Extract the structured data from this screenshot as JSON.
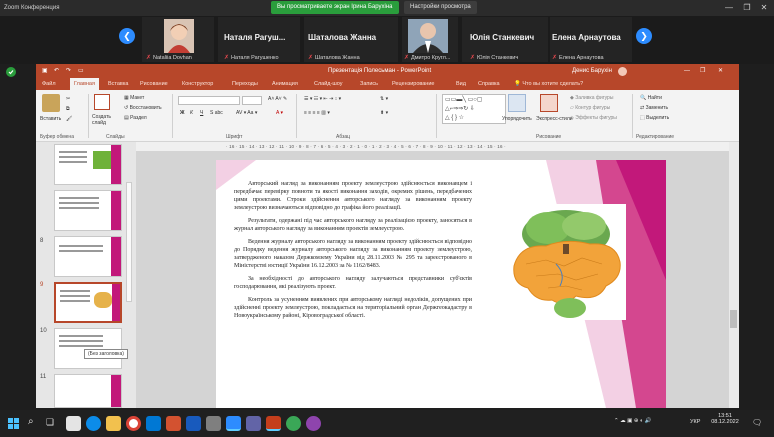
{
  "zoom": {
    "window_title": "Zoom Конференция",
    "share_banner": "Вы просматриваете экран Ірина Барухіна",
    "share_settings": "Настройки просмотра",
    "participants": [
      {
        "name": "Наталія Rатуш...",
        "sub": "Наталія Натуш..."
      },
      {
        "name": "",
        "sub": "Nataliia Dovhan"
      },
      {
        "name": "Наталя Рагуш...",
        "sub": "Наталя Рагушенко"
      },
      {
        "name": "Шаталова Жанна",
        "sub": "Шаталова Жанна"
      },
      {
        "name": "",
        "sub": "Дмитро Кругл..."
      },
      {
        "name": "Юлія Станкевич",
        "sub": "Юлія Станкевич"
      },
      {
        "name": "Елена Арнаутова",
        "sub": "Елена Арнаутова"
      }
    ],
    "controls": [
      "—",
      "❐",
      "✕"
    ]
  },
  "ppt": {
    "title": "Презентація Полесьман - PowerPoint",
    "user": "Денис Барухін",
    "tabs": [
      "Файл",
      "Главная",
      "Вставка",
      "Рисование",
      "Конструктор",
      "Переходы",
      "Анимация",
      "Слайд-шоу",
      "Запись",
      "Рецензирование",
      "Вид",
      "Справка",
      "Что вы хотите сделать?"
    ],
    "ribbon": {
      "clipboard_label": "Буфер обмена",
      "paste": "Вставить",
      "slides_label": "Слайды",
      "new_slide": "Создать слайд",
      "layout": "Макет",
      "reset": "Восстановить",
      "section": "Раздел",
      "font_label": "Шрифт",
      "paragraph_label": "Абзац",
      "drawing_label": "Рисование",
      "arrange": "Упорядочить",
      "styles": "Экспресс-стили",
      "fill": "Заливка фигуры",
      "outline": "Контур фигуры",
      "effects": "Эффекты фигуры",
      "editing_label": "Редактирование",
      "find": "Найти",
      "replace": "Заменить",
      "select": "Выделить"
    },
    "thumbnails": [
      {
        "num": ""
      },
      {
        "num": ""
      },
      {
        "num": "8"
      },
      {
        "num": "9"
      },
      {
        "num": "10"
      },
      {
        "num": "11"
      }
    ],
    "tooltip": "(Без заголовка)",
    "ruler": "· 16 · 15 · 14 · 13 · 12 · 11 · 10 · 9 · 8 · 7 · 6 · 5 · 4 · 3 · 2 · 1 · 0 · 1 · 2 · 3 · 4 · 5 · 6 · 7 · 8 · 9 · 10 · 11 · 12 · 13 · 14 · 15 · 16 ·",
    "slide_paragraphs": [
      "Авторський нагляд за виконанням проекту землеустрою здійснюється виконавцем і передбачає перевірку повноти та якості виконання заходів, окремих рішень, передбачених цими проектами. Строки здійснення авторського нагляду за виконанням проекту землеустрою визначаються відповідно до графіка його реалізації.",
      "Результати, одержані під час авторського нагляду за реалізацією проекту, заносяться в журнал авторського нагляду за виконанням проектів землеустрою.",
      "Ведення журналу авторського нагляду за виконанням проекту здійснюється відповідно до Порядку ведення журналу авторського нагляду за виконанням проекту землеустрою, затвердженого наказом Держкомзему України від 28.11.2003 № 295 та зареєстрованого в Міністерстві юстиції України 16.12.2003 за № 1162/8483.",
      "За необхідності до авторського нагляду залучаються представники суб'єктів господарювання, які реалізують проект.",
      "Контроль за усуненням виявлених при авторському нагляді недоліків, допущених при здійсненні проекту землеустрою, покладається на територіальний орган Держгеокадастру в Новоукраїнському районі, Кіровоградської області."
    ]
  },
  "taskbar": {
    "time": "13:51",
    "date": "08.12.2022",
    "lang": "УКР",
    "temp": "3°C"
  },
  "colors": {
    "ppt_accent": "#b7472a",
    "zoom_green": "#2a9d3c",
    "zoom_blue": "#2d8cff",
    "slide_magenta": "#c2187a"
  }
}
